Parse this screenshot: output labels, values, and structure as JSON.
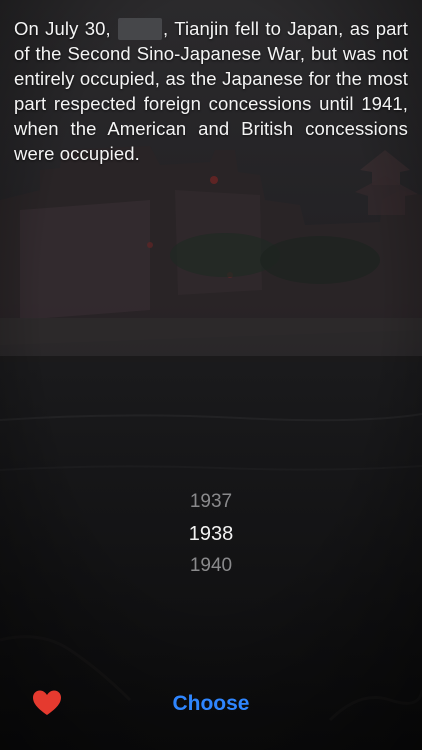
{
  "question": {
    "text_before_blank": "On July 30, ",
    "text_after_blank": ", Tianjin fell to Japan, as part of the Second Sino-Japanese War, but was not entirely occupied, as the Japanese for the most part respected foreign concessions until 1941, when the American and British concessions were occupied."
  },
  "year_picker": {
    "options": [
      "1937",
      "1938",
      "1940"
    ],
    "selected": "1938"
  },
  "footer": {
    "favorite_icon": "heart-icon",
    "choose_label": "Choose"
  },
  "colors": {
    "background": "#0e0e10",
    "text": "#f4f4f4",
    "accent": "#2f86ff",
    "heart": "#e53a2f"
  }
}
